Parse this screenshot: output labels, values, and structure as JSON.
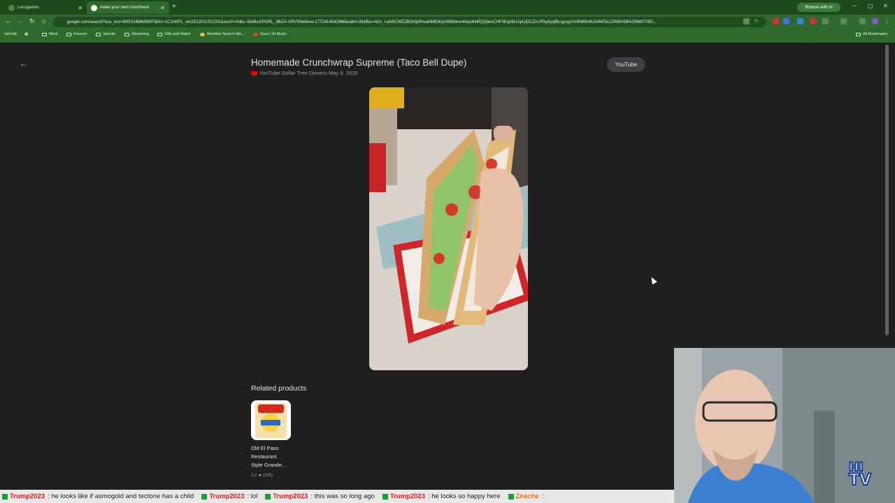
{
  "browser": {
    "tabs": [
      {
        "title": "Lessgames"
      },
      {
        "title": "make your own crunchwra"
      }
    ],
    "url": "google.com/search?sca_esv=90f15cf6663bf97f&rlz=1C1HKFL_enUS1201US1201&sxsrf=ANbL-n5eBx1rPDRL_3lbZA-XRV3Nwfevw:1772414542986&udm=39&fbs=ADc_l-aN0CWEZBOHjofHoaMMDiKpV6Bbbmv4VaoKkiRQ2jiwvCHF0Eqz8cUq4JjDCZnrJFky5yqfBcqysgzHz9N85mKAnR8TeLCR6bV5B423NW703G...",
    "browse_with_ai": "Browse with AI",
    "bookmarks": [
      "VanLife",
      "Work",
      "Finance",
      "VanLife",
      "Streaming",
      "Odd and Weird",
      "Weather Search We...",
      "Suno | AI Music"
    ],
    "all_bookmarks": "All Bookmarks"
  },
  "page": {
    "title": "Homemade Crunchwrap Supreme (Taco Bell Dupe)",
    "source": "YouTube",
    "channel": "Dollar Tree Dinners",
    "date": "May 9, 2025",
    "meta_sep": " · ",
    "open_button": "YouTube",
    "related_heading": "Related products",
    "product": {
      "name_lines": [
        "Old El Paso",
        "Restaurant",
        "Style Grande..."
      ],
      "rating": "3.2",
      "reviews": "(205)"
    }
  },
  "chat": [
    {
      "user": "Trump2023",
      "msg": ": he looks like if asmogold and tectone has a child"
    },
    {
      "user": "Trump2023",
      "msg": ": lol"
    },
    {
      "user": "Trump2023",
      "msg": ": this was so long ago"
    },
    {
      "user": "Trump2023",
      "msg": ": he looks so happy here"
    },
    {
      "user": "Znache",
      "msg": ":"
    }
  ],
  "overlay": {
    "logo_top": "HI",
    "logo_bottom": "TV"
  },
  "colors": {
    "browser_green": "#2e6a2e",
    "page_bg": "#1f1f1f",
    "chat_user": "#e0201f"
  }
}
